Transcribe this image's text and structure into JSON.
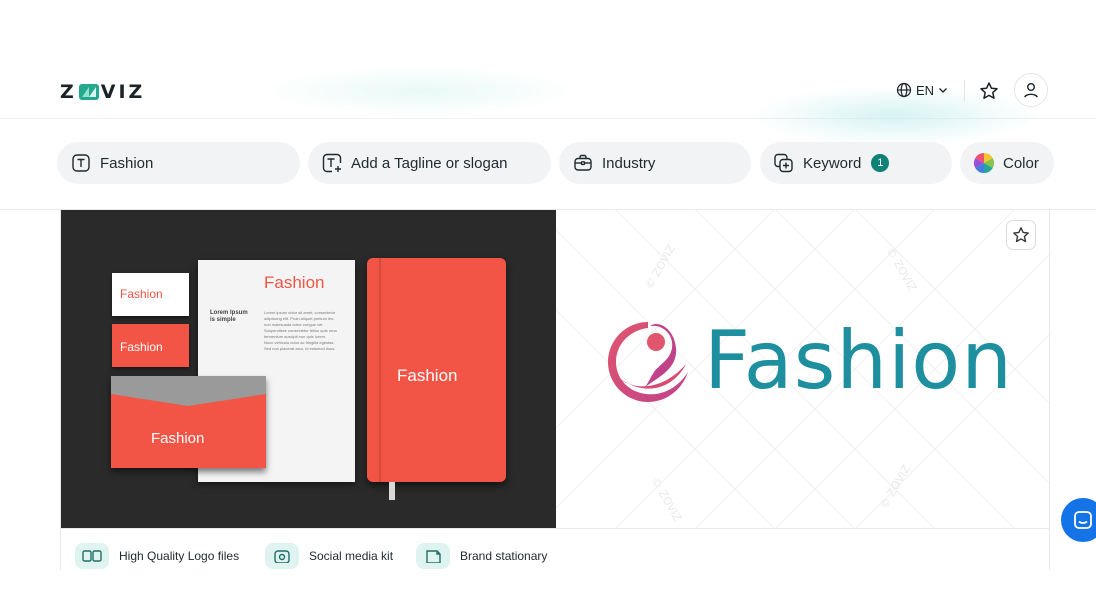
{
  "header": {
    "logo": {
      "left": "Z",
      "right": "VIZ",
      "icon": "zoviz-leaf-mark"
    },
    "language": {
      "label": "EN",
      "icon": "globe-icon",
      "caret": "chevron-down-icon"
    },
    "favorites_icon": "star-icon",
    "account_icon": "user-icon"
  },
  "filters": {
    "name": {
      "value": "Fashion",
      "icon": "text-t-icon"
    },
    "tagline": {
      "placeholder": "Add a Tagline or slogan",
      "icon": "text-add-icon"
    },
    "industry": {
      "placeholder": "Industry",
      "icon": "briefcase-icon"
    },
    "keyword": {
      "label": "Keyword",
      "count": "1",
      "icon": "keyword-add-icon"
    },
    "color": {
      "label": "Color",
      "icon": "color-wheel-icon"
    }
  },
  "card": {
    "mockup": {
      "brand": "Fashion",
      "letter_heading": "Lorem Ipsum\nis simple",
      "body_lines": [
        "Lorem ipsum dolor sit amet, consectetur",
        "adipiscing elit. Proin aliquet pretium leo,",
        "non malesuada tortor congue vel.",
        "Suspendisse consectetur tellus quis urna",
        "fermentum suscipit non quis lorem.",
        "Nunc vehicula dolor ac fringilla egestas.",
        "Sed non placerat arcu, id euismod risus."
      ]
    },
    "preview": {
      "brand": "Fashion",
      "watermark": "© ZOVIZ"
    },
    "favorite_icon": "star-outline-icon",
    "features": [
      {
        "label": "High Quality Logo files",
        "icon": "logo-files-icon"
      },
      {
        "label": "Social media kit",
        "icon": "social-kit-icon"
      },
      {
        "label": "Brand stationary",
        "icon": "stationary-icon"
      }
    ]
  },
  "chat": {
    "icon": "chat-icon"
  },
  "colors": {
    "accent": "#0f8177",
    "brand_red": "#f25545",
    "logo_teal": "#1d8f9e",
    "logo_pink": "#c9457b",
    "chat_blue": "#1473e6"
  }
}
